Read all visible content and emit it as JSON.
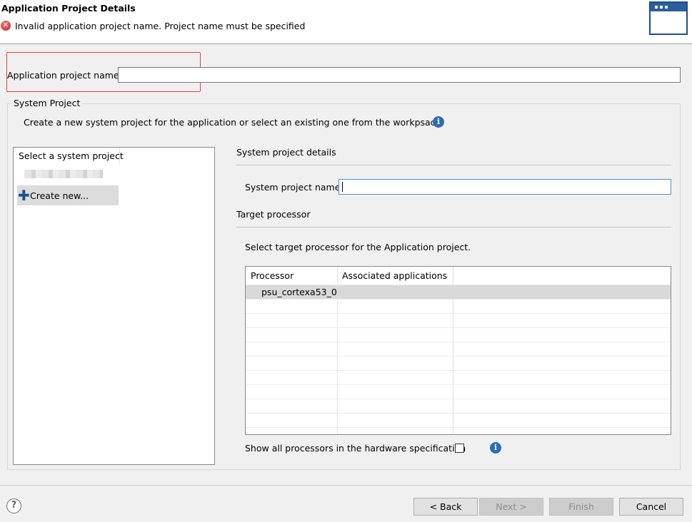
{
  "header": {
    "title": "Application Project Details",
    "error_message": "Invalid application project name. Project name must be specified"
  },
  "app_project": {
    "label": "Application project name:",
    "value": ""
  },
  "system_project": {
    "group_title": "System Project",
    "description": "Create a new system project for the application or select an existing one from the workpsace",
    "list_header": "Select a system project",
    "create_new_label": "Create new...",
    "details_title": "System project details",
    "name_label": "System project name:",
    "name_value": ""
  },
  "target_processor": {
    "title": "Target processor",
    "description": "Select target processor for the Application project.",
    "columns": [
      "Processor",
      "Associated applications"
    ],
    "rows": [
      {
        "processor": "psu_cortexa53_0",
        "associated": ""
      }
    ],
    "show_all_label": "Show all processors in the hardware specification",
    "show_all_checked": false
  },
  "footer": {
    "back_label": "< Back",
    "next_label": "Next >",
    "finish_label": "Finish",
    "cancel_label": "Cancel"
  },
  "icons": {
    "error": "error-circle-icon",
    "banner": "wizard-window-icon",
    "info": "info-icon",
    "help": "help-icon",
    "plus": "plus-icon"
  },
  "colors": {
    "highlight": "#e0433a",
    "accent": "#2c6db5",
    "focus_border": "#4d96c9"
  }
}
